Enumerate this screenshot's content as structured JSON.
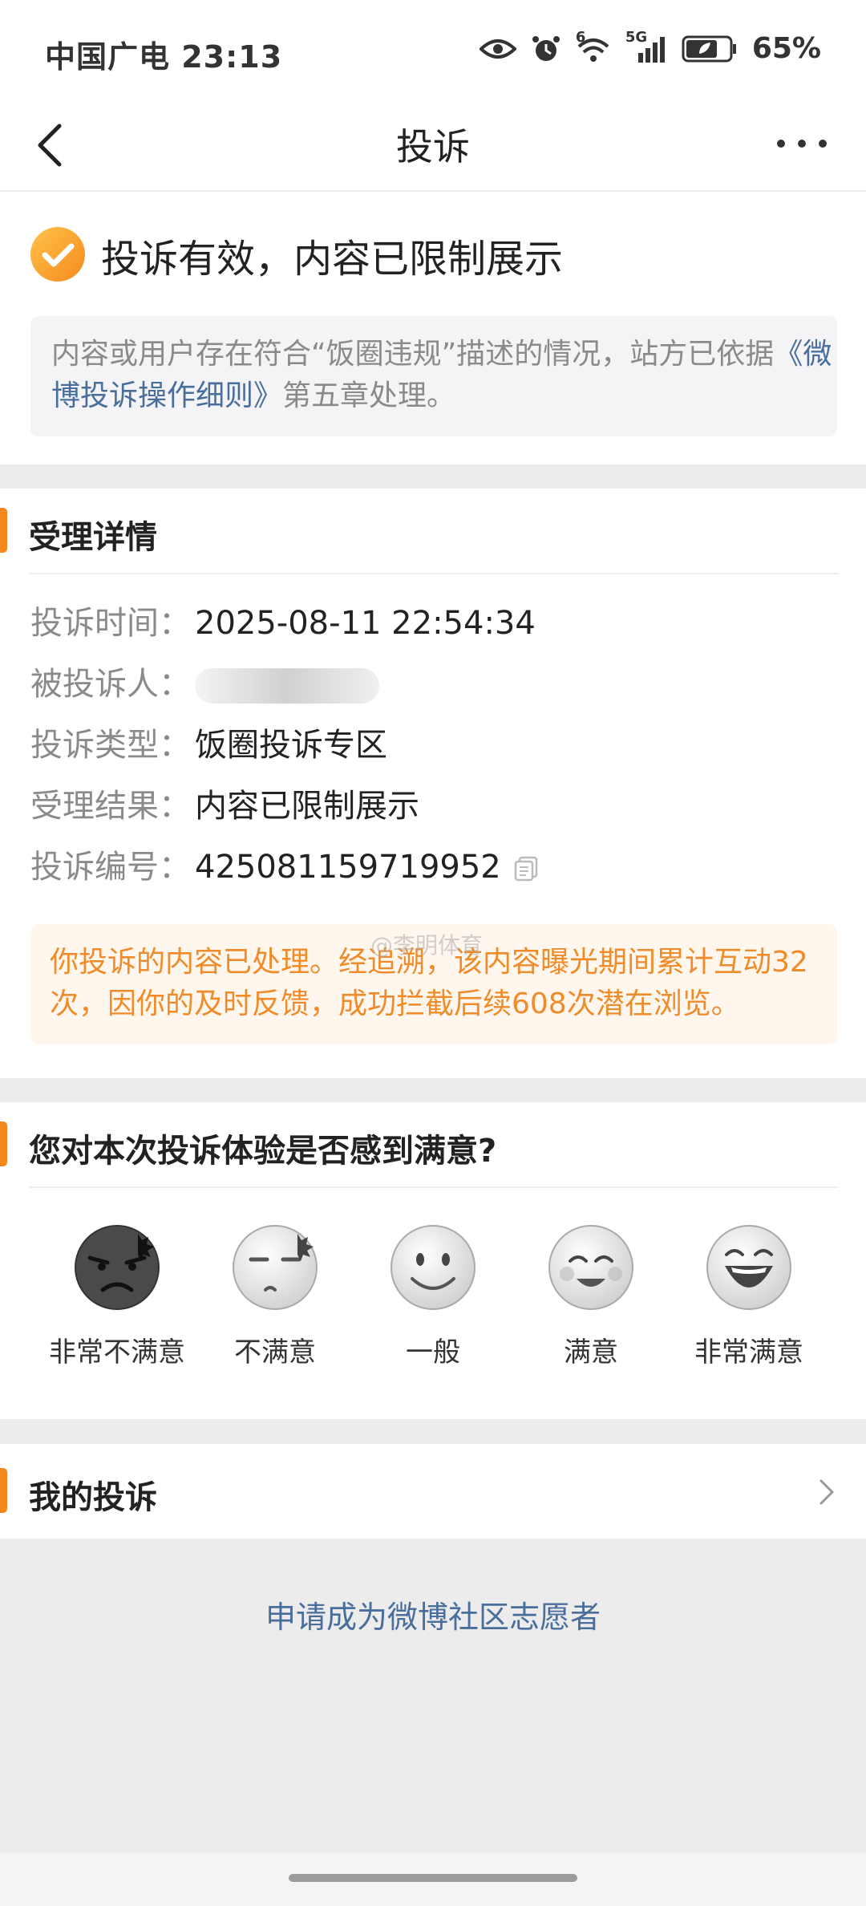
{
  "status_bar": {
    "carrier_time": "中国广电 23:13",
    "signal_label": "5G",
    "wifi_label": "6",
    "battery": "65%"
  },
  "nav": {
    "title": "投诉",
    "back_icon": "chevron-left-icon",
    "more_icon": "more-dots-icon"
  },
  "result": {
    "title": "投诉有效，内容已限制展示",
    "notice_prefix": "内容或用户存在符合“饭圈违规”描述的情况，站方已依据",
    "notice_link": "《微博投诉操作细则》",
    "notice_suffix": "第五章处理。"
  },
  "details": {
    "section_title": "受理详情",
    "rows": [
      {
        "label": "投诉时间：",
        "value": "2025-08-11 22:54:34"
      },
      {
        "label": "被投诉人：",
        "value": ""
      },
      {
        "label": "投诉类型：",
        "value": "饭圈投诉专区"
      },
      {
        "label": "受理结果：",
        "value": "内容已限制展示"
      },
      {
        "label": "投诉编号：",
        "value": "425081159719952"
      }
    ],
    "impact_text": "你投诉的内容已处理。经追溯，该内容曝光期间累计互动32次，因你的及时反馈，成功拦截后续608次潜在浏览。",
    "watermark": "@李明体育"
  },
  "satisfaction": {
    "question": "您对本次投诉体验是否感到满意?",
    "options": [
      {
        "label": "非常不满意",
        "icon": "very-dissatisfied-face-icon"
      },
      {
        "label": "不满意",
        "icon": "dissatisfied-face-icon"
      },
      {
        "label": "一般",
        "icon": "neutral-face-icon"
      },
      {
        "label": "满意",
        "icon": "satisfied-face-icon"
      },
      {
        "label": "非常满意",
        "icon": "very-satisfied-face-icon"
      }
    ]
  },
  "my_complaints": {
    "label": "我的投诉"
  },
  "volunteer_link": "申请成为微博社区志愿者",
  "colors": {
    "accent": "#f5871f",
    "link": "#4a6e9c",
    "success": "#f5a020"
  }
}
